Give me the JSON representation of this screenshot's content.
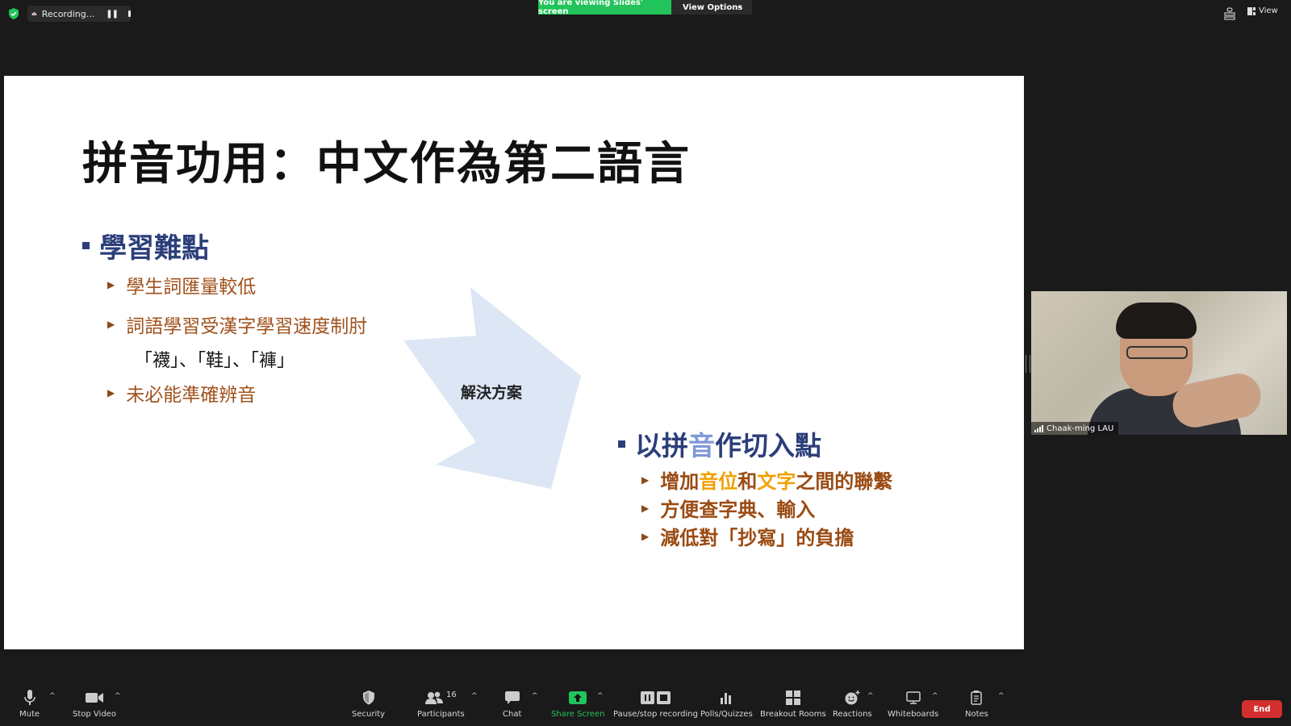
{
  "topbar": {
    "recording_label": "Recording...",
    "viewing_banner": "You are viewing Slides' screen",
    "view_options_label": "View Options",
    "view_label": "View"
  },
  "slide": {
    "title": "拼音功用：中文作為第二語言",
    "bullet1": "學習難點",
    "sub1": "學生詞匯量較低",
    "sub2": "詞語學習受漢字學習速度制肘",
    "examples": "「襪」、「鞋」、「褲」",
    "sub3": "未必能準確辨音",
    "arrow_label": "解決方案",
    "bullet2_pre": "以拼",
    "bullet2_hl": "音",
    "bullet2_post": "作切入點",
    "sub4_a": "增加",
    "sub4_b": "音位",
    "sub4_c": "和",
    "sub4_d": "文字",
    "sub4_e": "之間的聯繫",
    "sub5": "方便查字典、輸入",
    "sub6": "減低對「抄寫」的負擔"
  },
  "participant": {
    "name": "Chaak-ming LAU"
  },
  "toolbar": {
    "mute": "Mute",
    "stop_video": "Stop Video",
    "security": "Security",
    "participants": "Participants",
    "participants_count": "16",
    "chat": "Chat",
    "share_screen": "Share Screen",
    "pause_recording": "Pause/stop recording",
    "polls": "Polls/Quizzes",
    "breakout": "Breakout Rooms",
    "reactions": "Reactions",
    "whiteboards": "Whiteboards",
    "notes": "Notes",
    "end": "End"
  },
  "colors": {
    "share_green": "#22c35a",
    "end_red": "#d32f2f",
    "slide_blue": "#2c3e7a",
    "slide_brown": "#a0521d",
    "highlight_orange": "#f0a000"
  }
}
